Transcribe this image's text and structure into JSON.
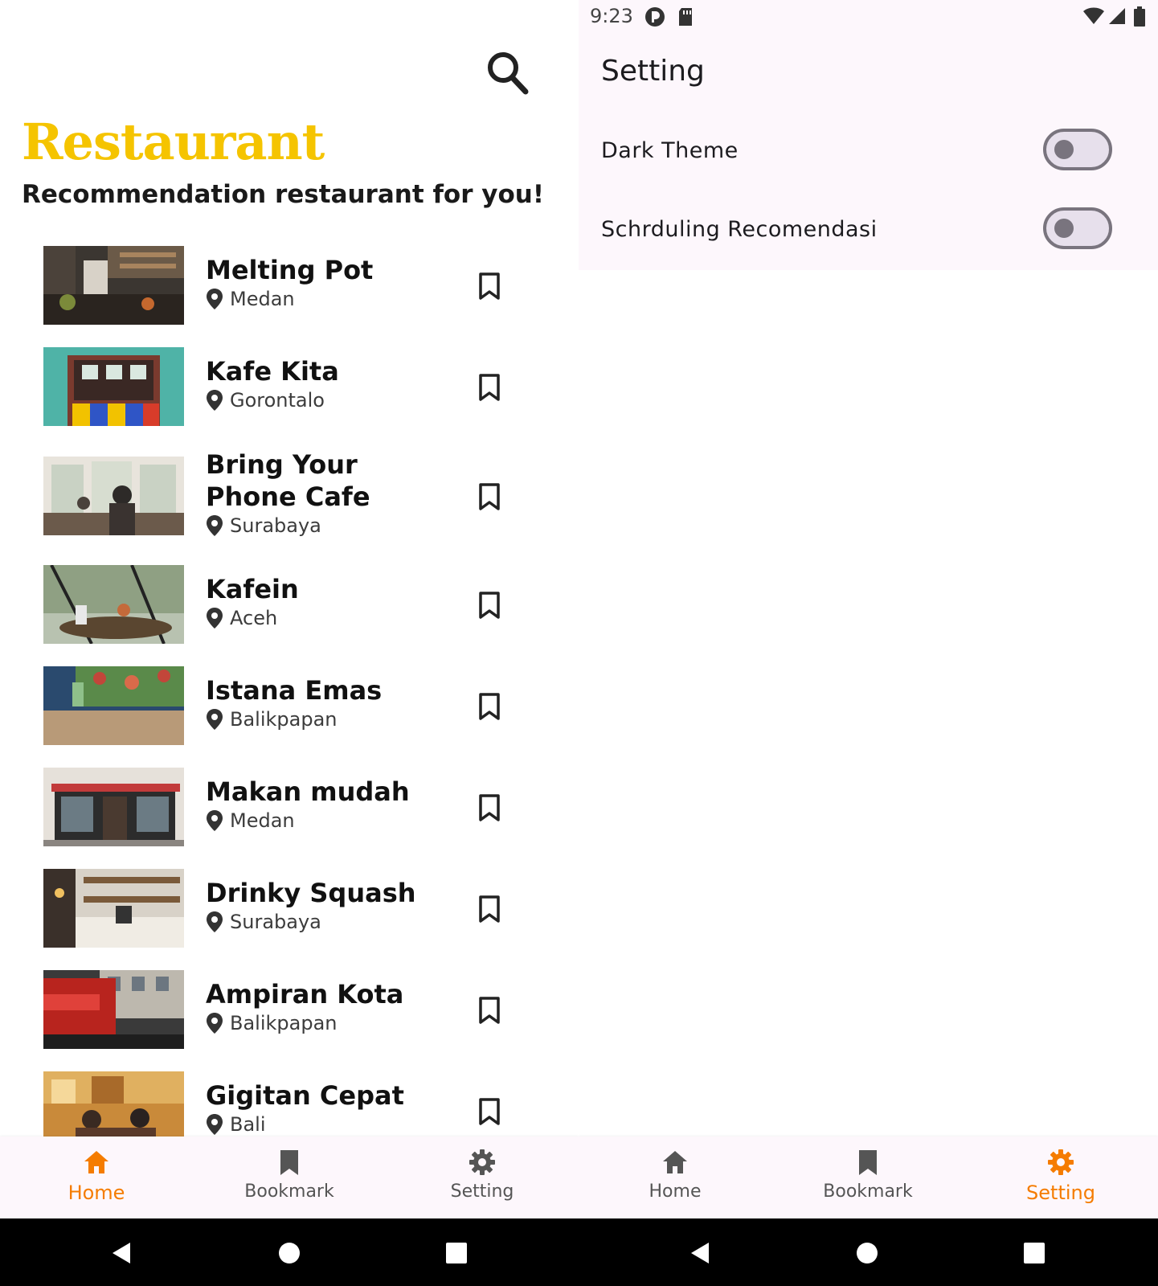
{
  "left": {
    "header": {
      "title": "Restaurant",
      "subtitle": "Recommendation restaurant for you!"
    },
    "restaurants": [
      {
        "name": "Melting Pot",
        "city": "Medan"
      },
      {
        "name": "Kafe Kita",
        "city": "Gorontalo"
      },
      {
        "name": "Bring Your Phone Cafe",
        "city": "Surabaya"
      },
      {
        "name": "Kafein",
        "city": "Aceh"
      },
      {
        "name": "Istana Emas",
        "city": "Balikpapan"
      },
      {
        "name": "Makan mudah",
        "city": "Medan"
      },
      {
        "name": "Drinky Squash",
        "city": "Surabaya"
      },
      {
        "name": "Ampiran Kota",
        "city": "Balikpapan"
      },
      {
        "name": "Gigitan Cepat",
        "city": "Bali"
      }
    ],
    "bottom_nav": {
      "home": "Home",
      "bookmark": "Bookmark",
      "setting": "Setting",
      "active": "home"
    }
  },
  "right": {
    "status_bar": {
      "time": "9:23"
    },
    "title": "Setting",
    "settings": [
      {
        "label": "Dark Theme",
        "enabled": false
      },
      {
        "label": "Schrduling Recomendasi",
        "enabled": false
      }
    ],
    "bottom_nav": {
      "home": "Home",
      "bookmark": "Bookmark",
      "setting": "Setting",
      "active": "setting"
    }
  },
  "colors": {
    "brand_yellow": "#f5c400",
    "active_orange": "#f57c00",
    "inactive_icon": "#555555",
    "nav_background": "#fdf7fc"
  }
}
